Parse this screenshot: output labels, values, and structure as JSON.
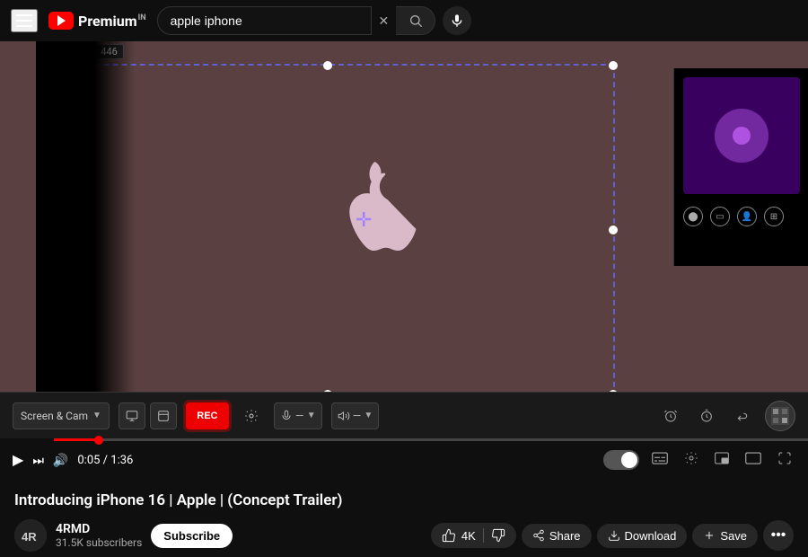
{
  "topbar": {
    "search_value": "apple iphone",
    "search_placeholder": "Search"
  },
  "video": {
    "title": "Introducing iPhone 16 | Apple | (Concept Trailer)",
    "size_w": "822",
    "size_h": "446",
    "time_current": "0:05",
    "time_total": "1:36"
  },
  "channel": {
    "name": "4RMD",
    "subscribers": "31.5K subscribers",
    "avatar_text": "4R"
  },
  "actions": {
    "like_count": "4K",
    "subscribe_label": "Subscribe",
    "share_label": "Share",
    "download_label": "Download",
    "save_label": "Save"
  },
  "recorder": {
    "cam_select_label": "Screen & Cam",
    "rec_label": "REC",
    "timer_label": "",
    "settings_label": ""
  }
}
